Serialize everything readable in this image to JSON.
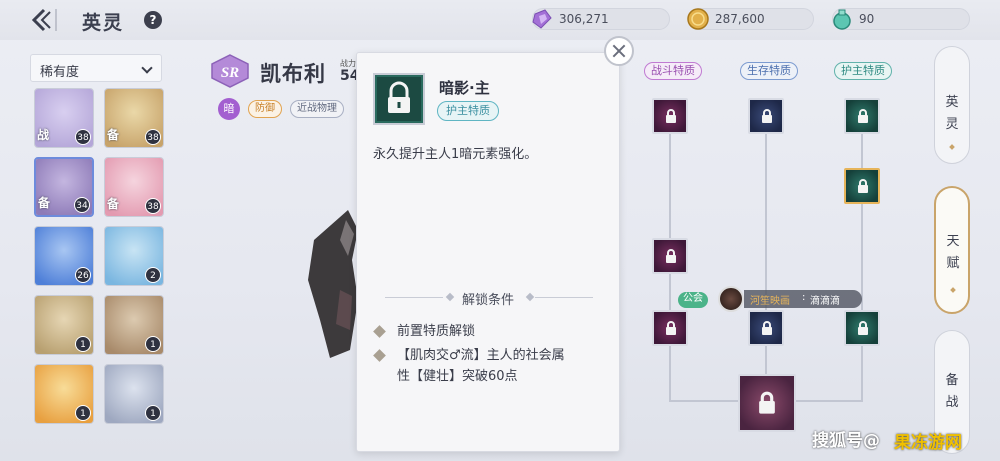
{
  "header": {
    "title": "英灵",
    "help": "?",
    "currencies": [
      {
        "icon": "crystal-icon",
        "value": "306,271"
      },
      {
        "icon": "gold-coin-icon",
        "value": "287,600"
      },
      {
        "icon": "potion-icon",
        "value": "90"
      }
    ]
  },
  "filter": {
    "rarity_label": "稀有度"
  },
  "heroes": [
    {
      "level": "38",
      "tag": "战",
      "colors": [
        "#b4a6d8",
        "#d8cff0"
      ]
    },
    {
      "level": "38",
      "tag": "备",
      "colors": [
        "#c7a36a",
        "#ead8a8"
      ]
    },
    {
      "level": "34",
      "tag": "备",
      "colors": [
        "#8e7bb8",
        "#c4b6e0"
      ],
      "selected": true
    },
    {
      "level": "38",
      "tag": "备",
      "colors": [
        "#e39ab0",
        "#f5d4de"
      ]
    },
    {
      "level": "26",
      "tag": "",
      "colors": [
        "#4e7fd8",
        "#a8c6f2"
      ]
    },
    {
      "level": "2",
      "tag": "",
      "colors": [
        "#7ab6e0",
        "#c8e4f4"
      ]
    },
    {
      "level": "1",
      "tag": "",
      "colors": [
        "#b8a070",
        "#e6d6b4"
      ]
    },
    {
      "level": "1",
      "tag": "",
      "colors": [
        "#a88a6a",
        "#dccab0"
      ]
    },
    {
      "level": "1",
      "tag": "",
      "colors": [
        "#e8a040",
        "#f8dc98"
      ]
    },
    {
      "level": "1",
      "tag": "",
      "colors": [
        "#9ea8c0",
        "#dce2ee"
      ]
    }
  ],
  "hero": {
    "rarity": "SR",
    "name": "凯布利",
    "power_label": "战力",
    "power_value": "54",
    "element": "暗",
    "roles": [
      "防御",
      "近战物理"
    ]
  },
  "popup": {
    "title": "暗影·主",
    "tag": "护主特质",
    "description": "永久提升主人1暗元素强化。",
    "unlock_title": "解锁条件",
    "conditions": [
      "前置特质解锁",
      "【肌肉交♂流】主人的社会属",
      "性【健壮】突破60点"
    ]
  },
  "talent_tree": {
    "headers": [
      "战斗特质",
      "生存特质",
      "护主特质"
    ]
  },
  "guild": {
    "tag": "公会",
    "name": "河笙映画",
    "colon": ":",
    "member": "滴滴滴"
  },
  "side_tabs": [
    {
      "chars": [
        "英",
        "灵"
      ]
    },
    {
      "chars": [
        "天",
        "赋"
      ]
    },
    {
      "chars": [
        "备",
        "战"
      ]
    }
  ],
  "watermark": {
    "text": "搜狐号@",
    "brand": "果冻游网"
  }
}
